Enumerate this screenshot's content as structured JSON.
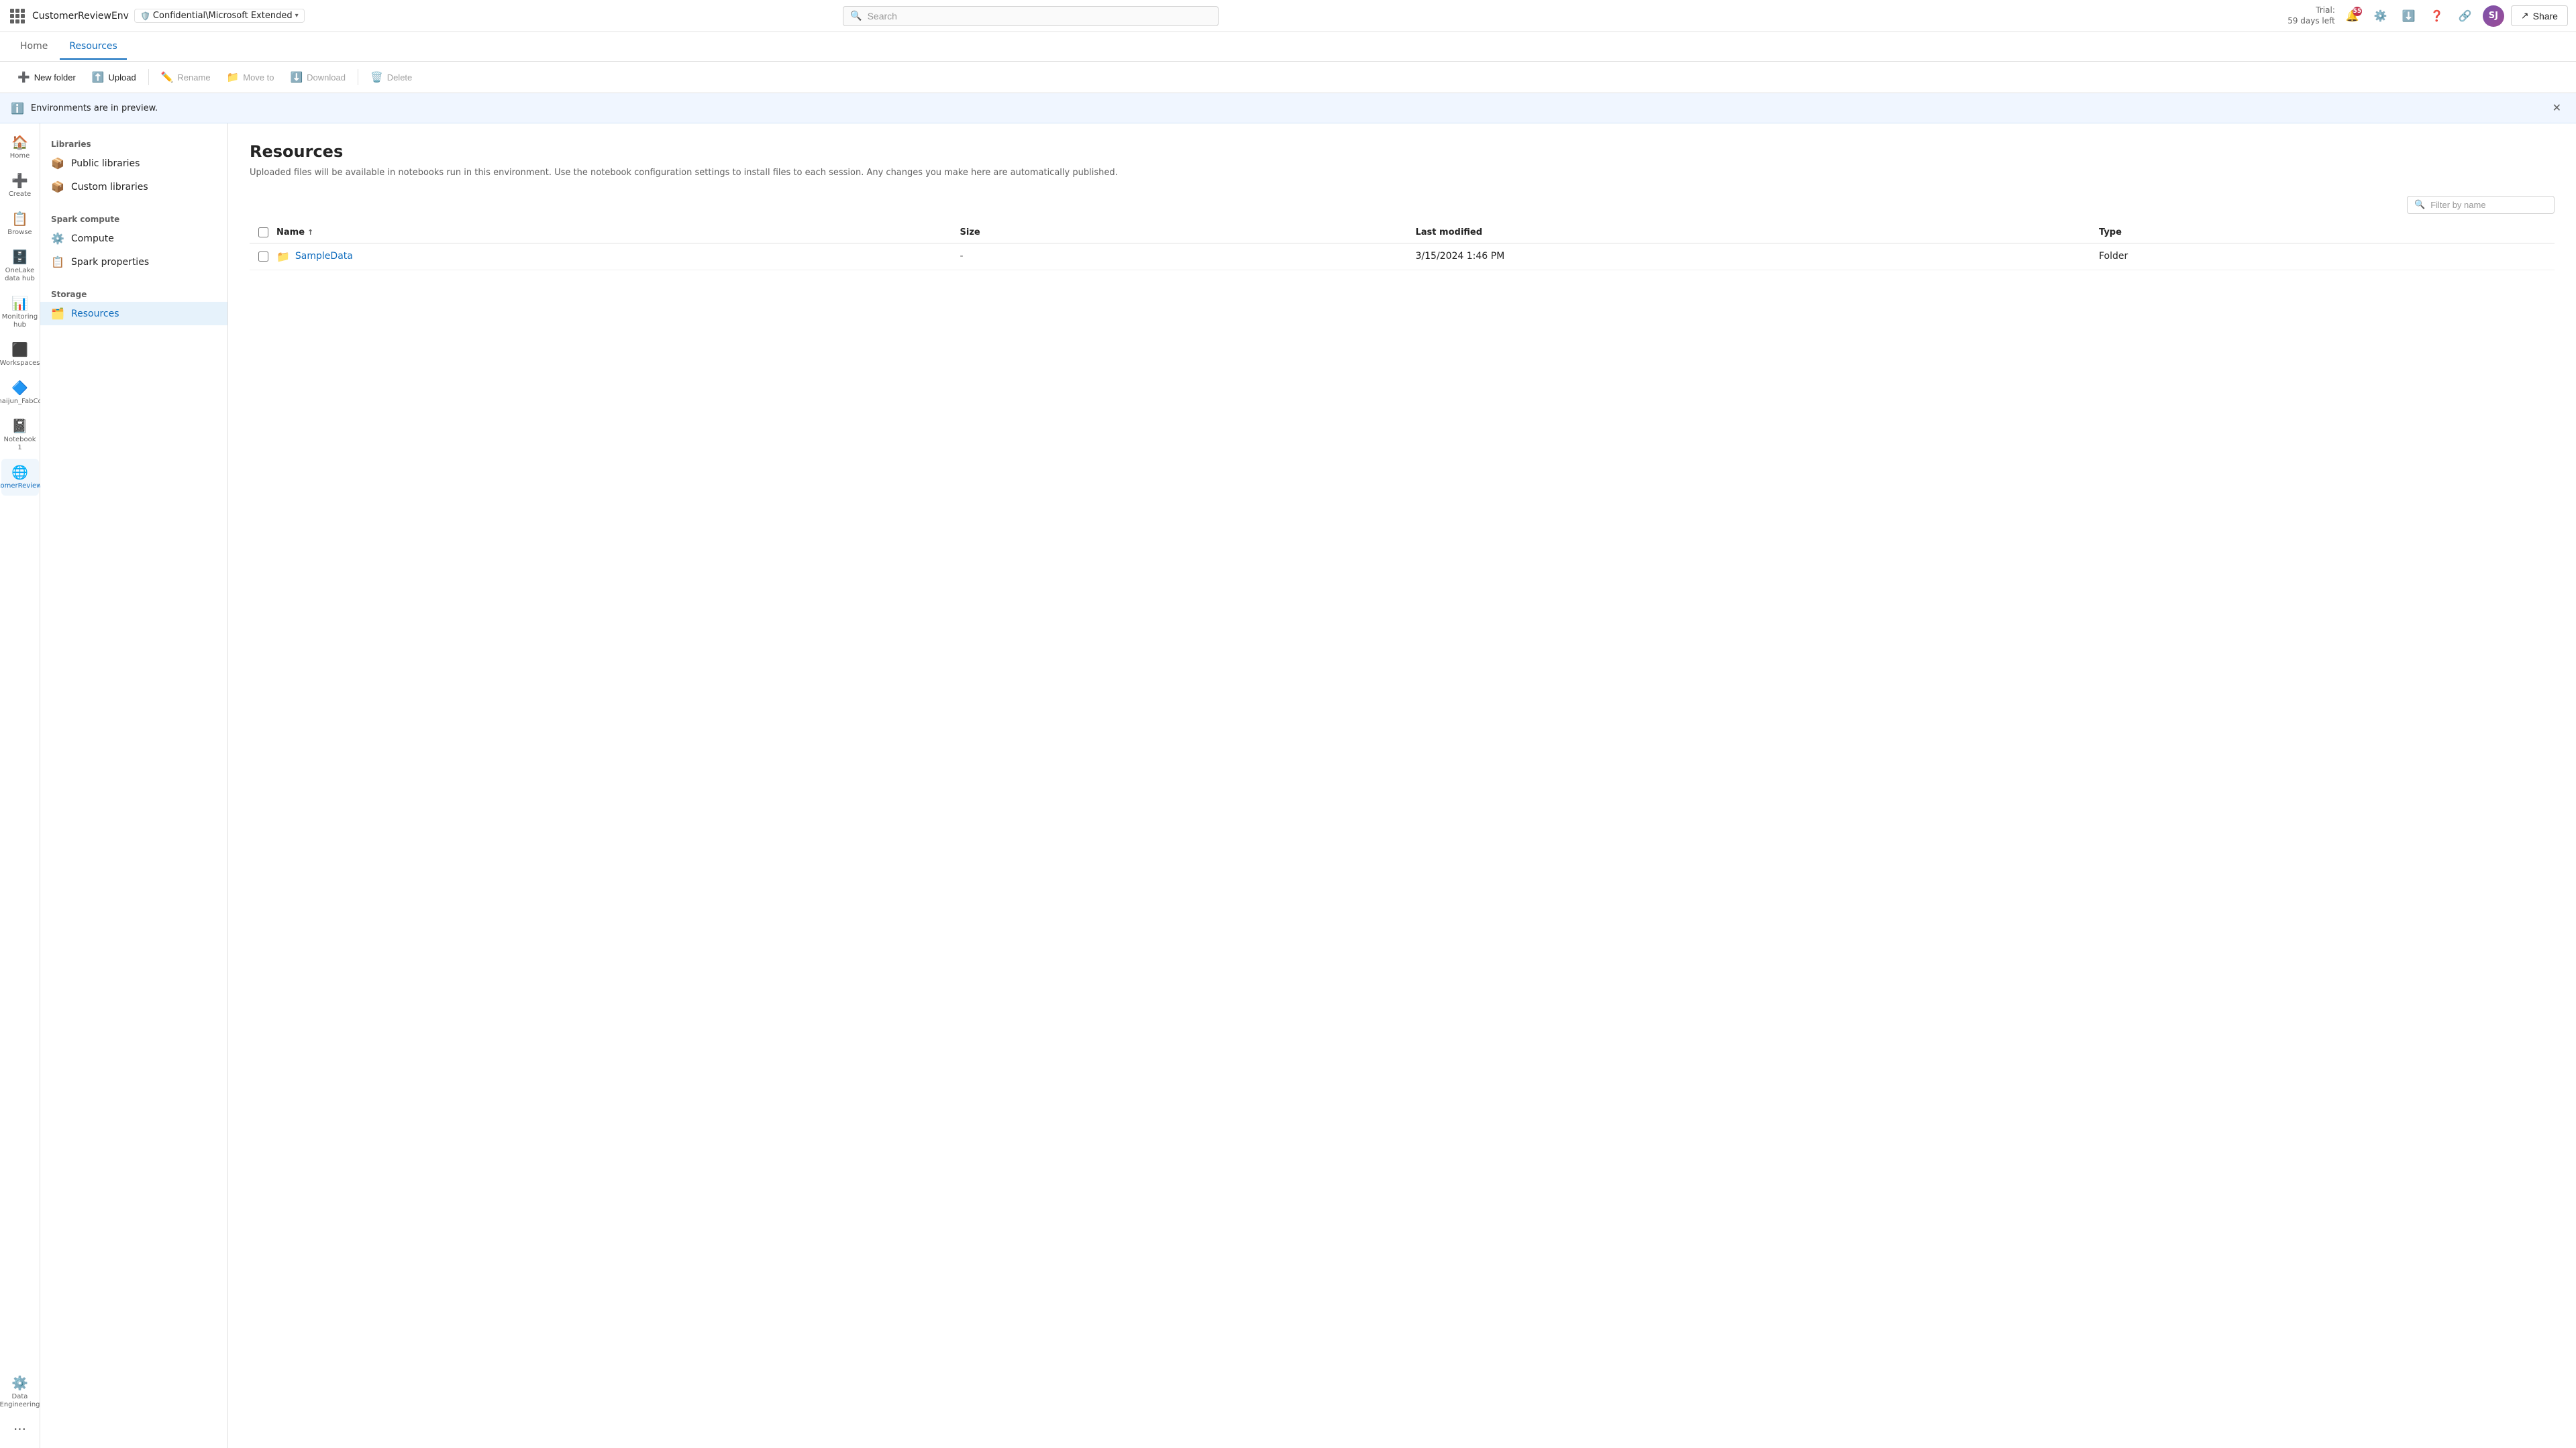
{
  "topbar": {
    "workspace_name": "CustomerReviewEnv",
    "confidentiality": "Confidential\\Microsoft Extended",
    "search_placeholder": "Search",
    "trial_line1": "Trial:",
    "trial_line2": "59 days left",
    "notification_count": "55",
    "avatar_initials": "SJ",
    "share_label": "Share"
  },
  "nav_tabs": [
    {
      "id": "home",
      "label": "Home"
    },
    {
      "id": "resources",
      "label": "Resources",
      "active": true
    }
  ],
  "toolbar": {
    "new_folder": "New folder",
    "upload": "Upload",
    "rename": "Rename",
    "move_to": "Move to",
    "download": "Download",
    "delete": "Delete"
  },
  "preview_banner": {
    "text": "Environments are in preview."
  },
  "left_sidebar": {
    "items": [
      {
        "id": "home",
        "label": "Home",
        "icon": "🏠"
      },
      {
        "id": "create",
        "label": "Create",
        "icon": "➕"
      },
      {
        "id": "browse",
        "label": "Browse",
        "icon": "📋"
      },
      {
        "id": "onelake",
        "label": "OneLake data hub",
        "icon": "🗄️"
      },
      {
        "id": "monitoring",
        "label": "Monitoring hub",
        "icon": "📊"
      },
      {
        "id": "workspaces",
        "label": "Workspaces",
        "icon": "⬛"
      },
      {
        "id": "shaijun",
        "label": "Shaijun_FabCon",
        "icon": "🔷"
      },
      {
        "id": "notebook1",
        "label": "Notebook 1",
        "icon": "📓"
      },
      {
        "id": "customerreview",
        "label": "CustomerReviewEnv",
        "icon": "🌐",
        "active": true
      },
      {
        "id": "data-engineering",
        "label": "Data Engineering",
        "icon": "⚙️"
      }
    ],
    "more_label": "..."
  },
  "env_nav": {
    "libraries_section": "Libraries",
    "libraries_items": [
      {
        "id": "public-libraries",
        "label": "Public libraries",
        "icon": "📦"
      },
      {
        "id": "custom-libraries",
        "label": "Custom libraries",
        "icon": "📦"
      }
    ],
    "spark_section": "Spark compute",
    "spark_items": [
      {
        "id": "compute",
        "label": "Compute",
        "icon": "⚙️"
      },
      {
        "id": "spark-properties",
        "label": "Spark properties",
        "icon": "📋"
      }
    ],
    "storage_section": "Storage",
    "storage_items": [
      {
        "id": "resources",
        "label": "Resources",
        "icon": "🗂️",
        "active": true
      }
    ]
  },
  "content": {
    "title": "Resources",
    "description": "Uploaded files will be available in notebooks run in this environment. Use the notebook configuration settings to install files to each session. Any changes you make here are automatically published.",
    "filter_placeholder": "Filter by name",
    "table": {
      "columns": [
        "Name",
        "Size",
        "Last modified",
        "Type"
      ],
      "rows": [
        {
          "name": "SampleData",
          "size": "-",
          "last_modified": "3/15/2024 1:46 PM",
          "type": "Folder"
        }
      ]
    }
  }
}
